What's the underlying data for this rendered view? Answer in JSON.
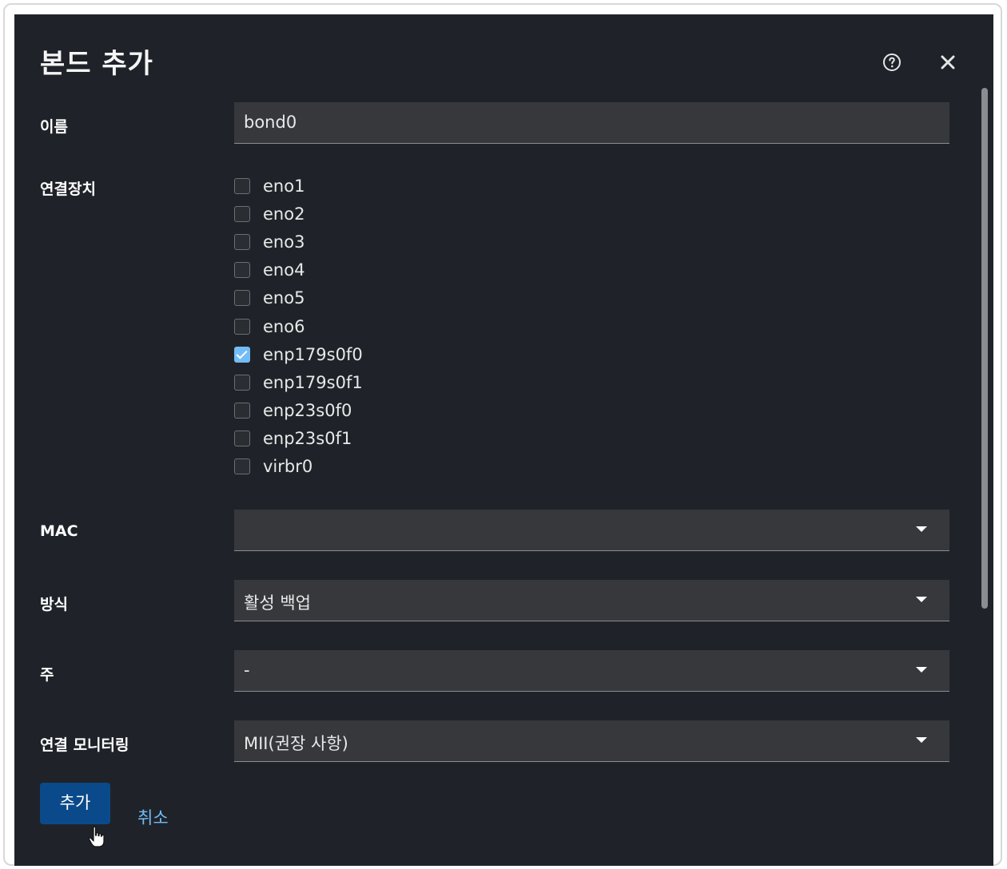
{
  "dialog": {
    "title": "본드 추가",
    "help_icon": "help-circle-icon",
    "close_icon": "close-icon"
  },
  "form": {
    "name": {
      "label": "이름",
      "value": "bond0"
    },
    "ports": {
      "label": "연결장치",
      "items": [
        {
          "name": "eno1",
          "checked": false
        },
        {
          "name": "eno2",
          "checked": false
        },
        {
          "name": "eno3",
          "checked": false
        },
        {
          "name": "eno4",
          "checked": false
        },
        {
          "name": "eno5",
          "checked": false
        },
        {
          "name": "eno6",
          "checked": false
        },
        {
          "name": "enp179s0f0",
          "checked": true
        },
        {
          "name": "enp179s0f1",
          "checked": false
        },
        {
          "name": "enp23s0f0",
          "checked": false
        },
        {
          "name": "enp23s0f1",
          "checked": false
        },
        {
          "name": "virbr0",
          "checked": false
        }
      ]
    },
    "mac": {
      "label": "MAC",
      "value": ""
    },
    "mode": {
      "label": "방식",
      "value": "활성 백업"
    },
    "primary": {
      "label": "주",
      "value": "-"
    },
    "link_monitoring": {
      "label": "연결 모니터링",
      "value": "MII(권장 사항)"
    }
  },
  "footer": {
    "add_label": "추가",
    "cancel_label": "취소"
  },
  "colors": {
    "dialog_bg": "#1f2329",
    "field_bg": "#36383c",
    "primary_button": "#0b4a8a",
    "link": "#73bcf7",
    "checkbox_checked": "#73bcf7"
  }
}
